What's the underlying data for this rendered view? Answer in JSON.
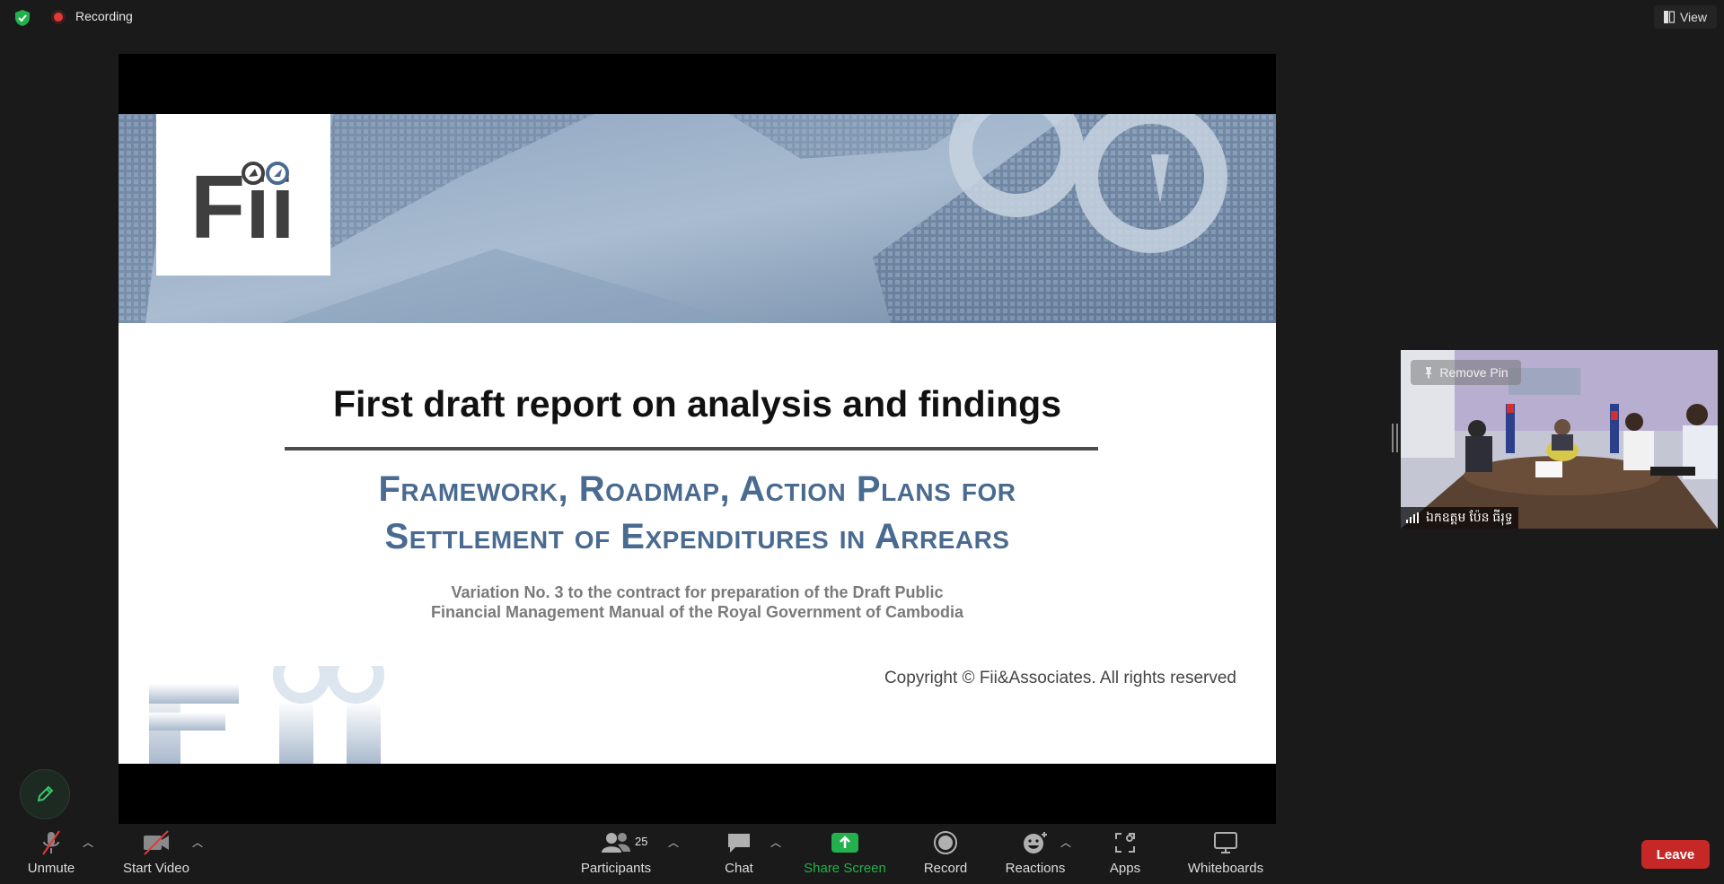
{
  "top_bar": {
    "recording_label": "Recording",
    "view_label": "View"
  },
  "slide": {
    "title": "First draft report on analysis and findings",
    "subtitle_line1": "Framework, Roadmap, Action Plans for",
    "subtitle_line2": "Settlement of Expenditures in Arrears",
    "variation_line1": "Variation No. 3 to the contract for preparation of the Draft Public",
    "variation_line2": "Financial Management Manual of the Royal Government of Cambodia",
    "copyright": "Copyright © Fii&Associates. All rights reserved",
    "logo_text": "Fii"
  },
  "participant_tile": {
    "remove_pin_label": "Remove Pin",
    "name": "ឯកឧត្តម ប៉ែន ធីរុទ្ធ"
  },
  "toolbar": {
    "unmute_label": "Unmute",
    "start_video_label": "Start Video",
    "participants_label": "Participants",
    "participants_count": "25",
    "chat_label": "Chat",
    "share_screen_label": "Share Screen",
    "record_label": "Record",
    "reactions_label": "Reactions",
    "apps_label": "Apps",
    "whiteboards_label": "Whiteboards",
    "leave_label": "Leave"
  },
  "colors": {
    "background": "#1a1a1a",
    "share_green": "#22b14c",
    "leave_red": "#c62828",
    "subtitle_blue": "#4a6b91"
  }
}
